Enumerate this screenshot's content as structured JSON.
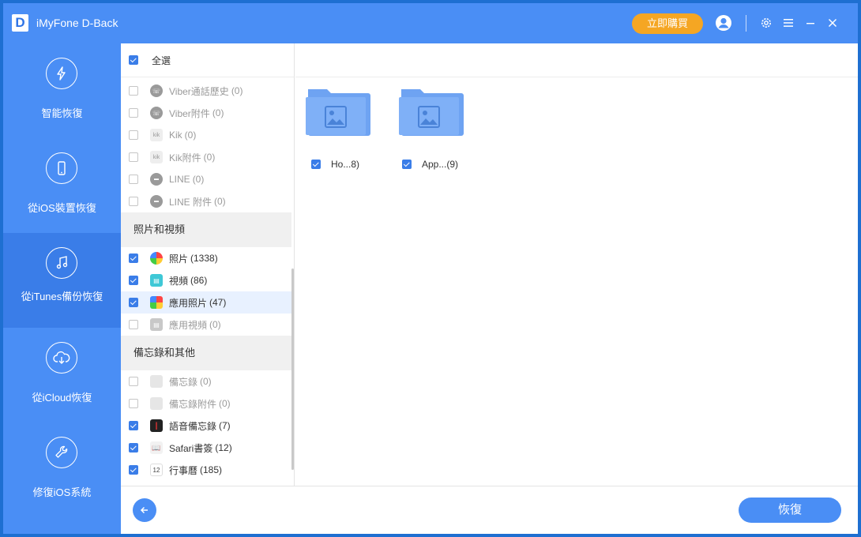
{
  "app": {
    "title": "iMyFone D-Back",
    "logo_letter": "D"
  },
  "titlebar": {
    "buy_label": "立即購買"
  },
  "sidebar": {
    "items": [
      {
        "label": "智能恢復",
        "icon": "lightning-refresh-icon",
        "active": false
      },
      {
        "label": "從iOS裝置恢復",
        "icon": "phone-refresh-icon",
        "active": false
      },
      {
        "label": "從iTunes備份恢復",
        "icon": "music-refresh-icon",
        "active": true
      },
      {
        "label": "從iCloud恢復",
        "icon": "cloud-download-icon",
        "active": false
      },
      {
        "label": "修復iOS系統",
        "icon": "wrench-icon",
        "active": false
      }
    ]
  },
  "categories": {
    "select_all_label": "全選",
    "group1": [
      {
        "label": "Viber通話歷史",
        "count": "(0)",
        "checked": false
      },
      {
        "label": "Viber附件",
        "count": "(0)",
        "checked": false
      },
      {
        "label": "Kik",
        "count": "(0)",
        "checked": false
      },
      {
        "label": "Kik附件",
        "count": "(0)",
        "checked": false
      },
      {
        "label": "LINE",
        "count": "(0)",
        "checked": false
      },
      {
        "label": "LINE 附件",
        "count": "(0)",
        "checked": false
      }
    ],
    "section_photos": "照片和視頻",
    "group2": [
      {
        "label": "照片",
        "count": "(1338)",
        "checked": true
      },
      {
        "label": "視頻",
        "count": "(86)",
        "checked": true
      },
      {
        "label": "應用照片",
        "count": "(47)",
        "checked": true
      },
      {
        "label": "應用視頻",
        "count": "(0)",
        "checked": false
      }
    ],
    "section_memo": "備忘錄和其他",
    "group3": [
      {
        "label": "備忘錄",
        "count": "(0)",
        "checked": false
      },
      {
        "label": "備忘錄附件",
        "count": "(0)",
        "checked": false
      },
      {
        "label": "語音備忘錄",
        "count": "(7)",
        "checked": true
      },
      {
        "label": "Safari書簽",
        "count": "(12)",
        "checked": true
      },
      {
        "label": "行事曆",
        "count": "(185)",
        "checked": true
      }
    ],
    "calendar_day": "12"
  },
  "folders": [
    {
      "label": "Ho...8)",
      "checked": true
    },
    {
      "label": "App...(9)",
      "checked": true
    }
  ],
  "footer": {
    "recover_label": "恢復"
  },
  "colors": {
    "accent": "#4a8ef5",
    "buy": "#f5a623",
    "check": "#3a7de8"
  }
}
